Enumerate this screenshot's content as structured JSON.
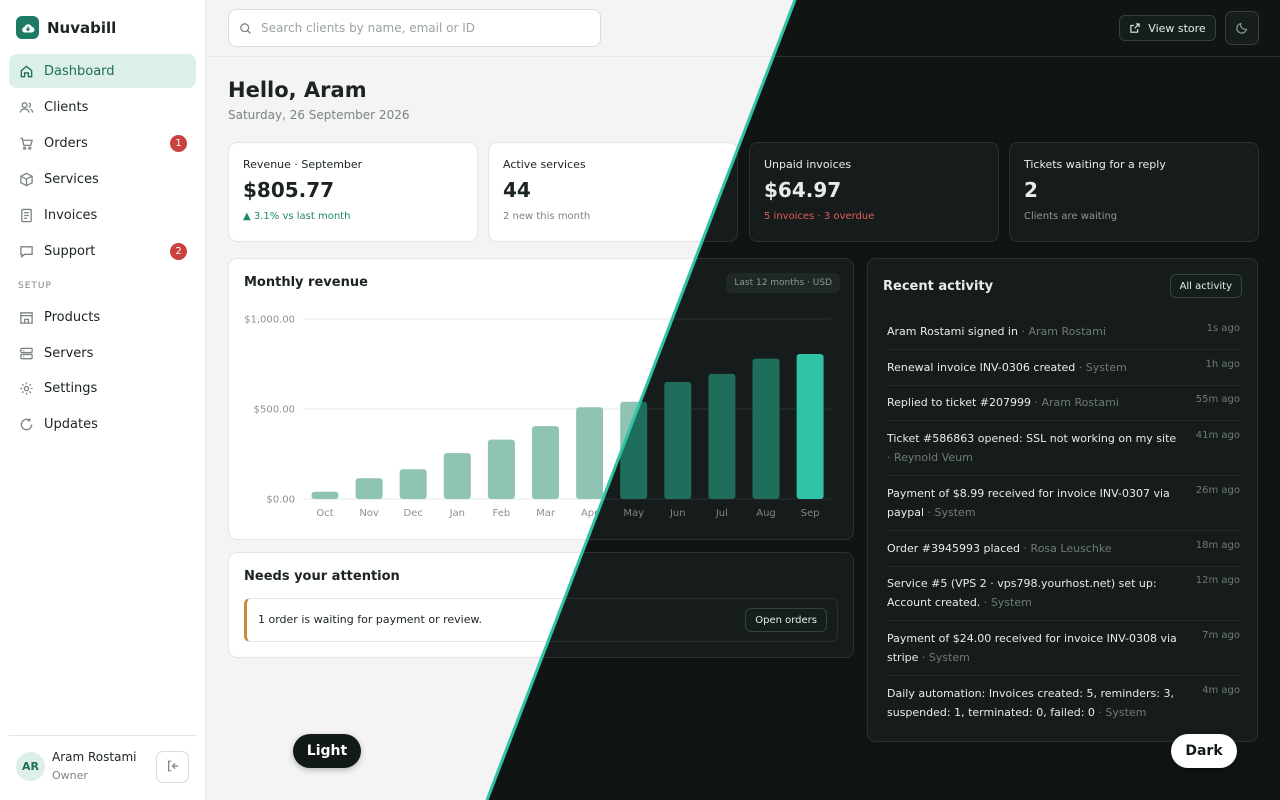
{
  "brand": {
    "name": "Nuvabill"
  },
  "sidebar": {
    "items": [
      {
        "label": "Dashboard",
        "icon": "home-icon",
        "active": true
      },
      {
        "label": "Clients",
        "icon": "users-icon"
      },
      {
        "label": "Orders",
        "icon": "cart-icon",
        "badge": "1"
      },
      {
        "label": "Services",
        "icon": "box-icon"
      },
      {
        "label": "Invoices",
        "icon": "invoice-icon"
      },
      {
        "label": "Support",
        "icon": "chat-icon",
        "badge": "2"
      }
    ],
    "setup_label": "SETUP",
    "setup_items": [
      {
        "label": "Products",
        "icon": "store-icon"
      },
      {
        "label": "Servers",
        "icon": "server-icon"
      },
      {
        "label": "Settings",
        "icon": "gear-icon"
      },
      {
        "label": "Updates",
        "icon": "refresh-icon"
      }
    ],
    "user": {
      "initials": "AR",
      "name": "Aram Rostami",
      "role": "Owner"
    }
  },
  "topbar": {
    "search_placeholder": "Search clients by name, email or ID",
    "view_store": "View store"
  },
  "header": {
    "greeting": "Hello, Aram",
    "date": "Saturday, 26 September 2026"
  },
  "stats": [
    {
      "label": "Revenue · September",
      "value": "$805.77",
      "sub": "▲ 3.1% vs last month",
      "tone": "good"
    },
    {
      "label": "Active services",
      "value": "44",
      "sub": "2 new this month",
      "tone": ""
    },
    {
      "label": "Unpaid invoices",
      "value": "$64.97",
      "sub": "5 invoices · 3 overdue",
      "tone": "bad"
    },
    {
      "label": "Tickets waiting for a reply",
      "value": "2",
      "sub": "Clients are waiting",
      "tone": ""
    }
  ],
  "revenue_panel": {
    "title": "Monthly revenue",
    "range": "Last 12 months · USD"
  },
  "chart_data": {
    "type": "bar",
    "categories": [
      "Oct",
      "Nov",
      "Dec",
      "Jan",
      "Feb",
      "Mar",
      "Apr",
      "May",
      "Jun",
      "Jul",
      "Aug",
      "Sep"
    ],
    "values": [
      40,
      115,
      165,
      255,
      330,
      405,
      510,
      540,
      650,
      695,
      780,
      805.77
    ],
    "ylim": [
      0,
      1000
    ],
    "yticks": [
      "$0.00",
      "$500.00",
      "$1,000.00"
    ],
    "ytick_values": [
      0,
      500,
      1000
    ],
    "grid": true
  },
  "attention": {
    "title": "Needs your attention",
    "message": "1 order is waiting for payment or review.",
    "button": "Open orders"
  },
  "activity": {
    "title": "Recent activity",
    "button": "All activity",
    "items": [
      {
        "text": "Aram Rostami signed in",
        "who": "Aram Rostami",
        "time": "1s ago"
      },
      {
        "text": "Renewal invoice INV-0306 created",
        "who": "System",
        "time": "1h ago"
      },
      {
        "text": "Replied to ticket #207999",
        "who": "Aram Rostami",
        "time": "55m ago"
      },
      {
        "text": "Ticket #586863 opened: SSL not working on my site",
        "who": "Reynold Veum",
        "time": "41m ago"
      },
      {
        "text": "Payment of $8.99 received for invoice INV-0307 via paypal",
        "who": "System",
        "time": "26m ago"
      },
      {
        "text": "Order #3945993 placed",
        "who": "Rosa Leuschke",
        "time": "18m ago"
      },
      {
        "text": "Service #5 (VPS 2 · vps798.yourhost.net) set up: Account created.",
        "who": "System",
        "time": "12m ago"
      },
      {
        "text": "Payment of $24.00 received for invoice INV-0308 via stripe",
        "who": "System",
        "time": "7m ago"
      },
      {
        "text": "Daily automation: Invoices created: 5, reminders: 3, suspended: 1, terminated: 0, failed: 0",
        "who": "System",
        "time": "4m ago"
      }
    ]
  },
  "modes": {
    "light": "Light",
    "dark": "Dark"
  },
  "colors": {
    "accent": "#1d7a63",
    "bar_light": "#8fc4b5",
    "bar_dark": "#1f6e5c",
    "bar_current": "#2fc4a6",
    "divider": "#2ec4a5"
  }
}
